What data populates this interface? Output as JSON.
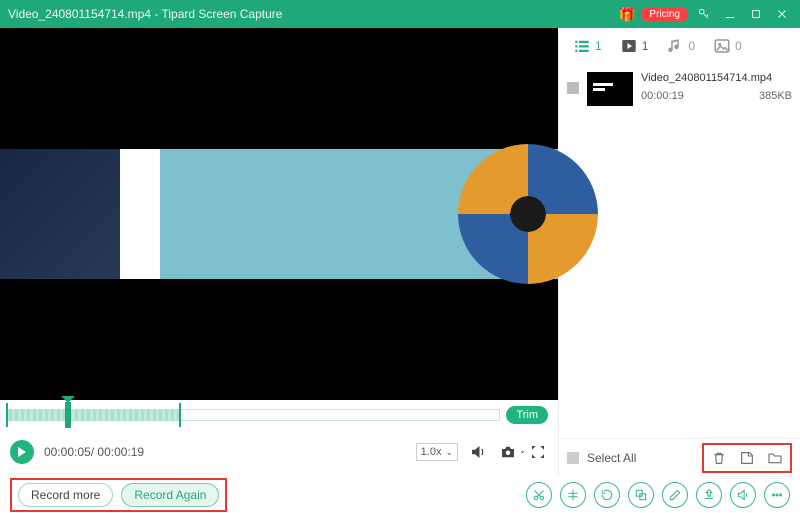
{
  "titlebar": {
    "filename": "Video_240801154714.mp4",
    "sep": "  -  ",
    "app": "Tipard Screen Capture",
    "pricing_label": "Pricing"
  },
  "timeline": {
    "trim_label": "Trim"
  },
  "controls": {
    "current": "00:00:05",
    "sep": "/ ",
    "duration": "00:00:19",
    "speed": "1.0x"
  },
  "filters": {
    "list_count": "1",
    "video_count": "1",
    "audio_count": "0",
    "image_count": "0"
  },
  "file": {
    "name": "Video_240801154714.mp4",
    "duration": "00:00:19",
    "size": "385KB"
  },
  "selectall_label": "Select All",
  "buttons": {
    "record_more": "Record more",
    "record_again": "Record Again"
  }
}
